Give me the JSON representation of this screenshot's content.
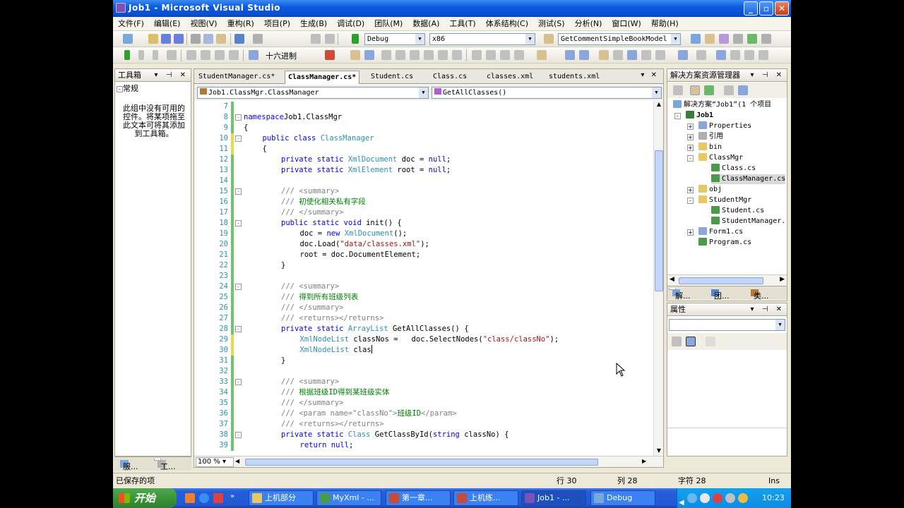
{
  "window": {
    "title": "Job1 - Microsoft Visual Studio"
  },
  "menu": [
    "文件(F)",
    "编辑(E)",
    "视图(V)",
    "重构(R)",
    "项目(P)",
    "生成(B)",
    "调试(D)",
    "团队(M)",
    "数据(A)",
    "工具(T)",
    "体系结构(C)",
    "测试(S)",
    "分析(N)",
    "窗口(W)",
    "帮助(H)"
  ],
  "toolbar": {
    "config": "Debug",
    "platform": "x86",
    "find_combo": "GetCommentSimpleBookModel",
    "hex_label": "十六进制"
  },
  "toolbox": {
    "title": "工具箱",
    "group": "常规",
    "empty_message": "此组中没有可用的控件。将某项拖至此文本可将其添加到工具箱。",
    "bottom_tabs": [
      "服...",
      "工..."
    ]
  },
  "editor": {
    "tabs": [
      "StudentManager.cs*",
      "ClassManager.cs*",
      "Student.cs",
      "Class.cs",
      "classes.xml",
      "students.xml"
    ],
    "active_tab": 1,
    "type_combo": "Job1.ClassMgr.ClassManager",
    "member_combo": "GetAllClasses()",
    "zoom": "100 %",
    "lines": [
      {
        "n": "7",
        "indent": 0,
        "tokens": []
      },
      {
        "n": "8",
        "indent": 0,
        "fold": "-",
        "tokens": [
          [
            "kw",
            "namespace"
          ],
          [
            "",
            "Job1.ClassMgr"
          ]
        ]
      },
      {
        "n": "9",
        "indent": 0,
        "tokens": [
          [
            "",
            "{"
          ]
        ]
      },
      {
        "n": "10",
        "indent": 1,
        "fold": "-",
        "tokens": [
          [
            "kw",
            "public class "
          ],
          [
            "ty",
            "ClassManager"
          ]
        ]
      },
      {
        "n": "11",
        "indent": 1,
        "tokens": [
          [
            "",
            "{"
          ]
        ]
      },
      {
        "n": "12",
        "indent": 2,
        "tokens": [
          [
            "kw",
            "private static "
          ],
          [
            "ty",
            "XmlDocument"
          ],
          [
            "",
            " doc = "
          ],
          [
            "kw",
            "null"
          ],
          [
            "",
            ";"
          ]
        ]
      },
      {
        "n": "13",
        "indent": 2,
        "tokens": [
          [
            "kw",
            "private static "
          ],
          [
            "ty",
            "XmlElement"
          ],
          [
            "",
            " root = "
          ],
          [
            "kw",
            "null"
          ],
          [
            "",
            ";"
          ]
        ]
      },
      {
        "n": "14",
        "indent": 0,
        "tokens": []
      },
      {
        "n": "15",
        "indent": 2,
        "fold": "-",
        "tokens": [
          [
            "cg",
            "/// <summary>"
          ]
        ]
      },
      {
        "n": "16",
        "indent": 2,
        "tokens": [
          [
            "cg",
            "/// "
          ],
          [
            "cm",
            "初使化相关私有字段"
          ]
        ]
      },
      {
        "n": "17",
        "indent": 2,
        "tokens": [
          [
            "cg",
            "/// </summary>"
          ]
        ]
      },
      {
        "n": "18",
        "indent": 2,
        "fold": "-",
        "tokens": [
          [
            "kw",
            "public static void "
          ],
          [
            "",
            "init() {"
          ]
        ]
      },
      {
        "n": "19",
        "indent": 3,
        "tokens": [
          [
            "",
            "doc = "
          ],
          [
            "kw",
            "new "
          ],
          [
            "ty",
            "XmlDocument"
          ],
          [
            "",
            "();"
          ]
        ]
      },
      {
        "n": "20",
        "indent": 3,
        "tokens": [
          [
            "",
            "doc.Load("
          ],
          [
            "st",
            "\"data/classes.xml\""
          ],
          [
            "",
            ");"
          ]
        ]
      },
      {
        "n": "21",
        "indent": 3,
        "tokens": [
          [
            "",
            "root = doc.DocumentElement;"
          ]
        ]
      },
      {
        "n": "22",
        "indent": 2,
        "tokens": [
          [
            "",
            "}"
          ]
        ]
      },
      {
        "n": "23",
        "indent": 0,
        "tokens": []
      },
      {
        "n": "24",
        "indent": 2,
        "fold": "-",
        "tokens": [
          [
            "cg",
            "/// <summary>"
          ]
        ]
      },
      {
        "n": "25",
        "indent": 2,
        "tokens": [
          [
            "cg",
            "/// "
          ],
          [
            "cm",
            "得到所有班级列表"
          ]
        ]
      },
      {
        "n": "26",
        "indent": 2,
        "tokens": [
          [
            "cg",
            "/// </summary>"
          ]
        ]
      },
      {
        "n": "27",
        "indent": 2,
        "tokens": [
          [
            "cg",
            "/// <returns></returns>"
          ]
        ]
      },
      {
        "n": "28",
        "indent": 2,
        "fold": "-",
        "tokens": [
          [
            "kw",
            "private static "
          ],
          [
            "ty",
            "ArrayList"
          ],
          [
            "",
            " GetAllClasses() {"
          ]
        ]
      },
      {
        "n": "29",
        "indent": 3,
        "tokens": [
          [
            "ty",
            "XmlNodeList"
          ],
          [
            "",
            " classNos =   doc.SelectNodes("
          ],
          [
            "st",
            "\"class/classNo\""
          ],
          [
            "",
            ");"
          ]
        ]
      },
      {
        "n": "30",
        "indent": 3,
        "tokens": [
          [
            "ty",
            "XmlNodeList"
          ],
          [
            "",
            " clas"
          ]
        ]
      },
      {
        "n": "31",
        "indent": 2,
        "tokens": [
          [
            "",
            "}"
          ]
        ]
      },
      {
        "n": "32",
        "indent": 0,
        "tokens": []
      },
      {
        "n": "33",
        "indent": 2,
        "fold": "-",
        "tokens": [
          [
            "cg",
            "/// <summary>"
          ]
        ]
      },
      {
        "n": "34",
        "indent": 2,
        "tokens": [
          [
            "cg",
            "/// "
          ],
          [
            "cm",
            "根据班级ID得到某班级实体"
          ]
        ]
      },
      {
        "n": "35",
        "indent": 2,
        "tokens": [
          [
            "cg",
            "/// </summary>"
          ]
        ]
      },
      {
        "n": "36",
        "indent": 2,
        "tokens": [
          [
            "cg",
            "/// <param name=\"classNo\">"
          ],
          [
            "cm",
            "班级ID"
          ],
          [
            "cg",
            "</param>"
          ]
        ]
      },
      {
        "n": "37",
        "indent": 2,
        "tokens": [
          [
            "cg",
            "/// <returns></returns>"
          ]
        ]
      },
      {
        "n": "38",
        "indent": 2,
        "fold": "-",
        "tokens": [
          [
            "kw",
            "private static "
          ],
          [
            "ty",
            "Class"
          ],
          [
            "",
            " GetClassById("
          ],
          [
            "kw",
            "string"
          ],
          [
            "",
            " classNo) {"
          ]
        ]
      },
      {
        "n": "39",
        "indent": 3,
        "tokens": [
          [
            "kw",
            "return null"
          ],
          [
            "",
            ";"
          ]
        ]
      }
    ]
  },
  "solution_explorer": {
    "title": "解决方案资源管理器",
    "items": [
      {
        "label": "解决方案“Job1”(1 个项目",
        "level": 0,
        "icon": "solution-icon",
        "expander": ""
      },
      {
        "label": "Job1",
        "level": 1,
        "icon": "project-icon",
        "expander": "-",
        "bold": true
      },
      {
        "label": "Properties",
        "level": 2,
        "icon": "properties-icon",
        "expander": "+"
      },
      {
        "label": "引用",
        "level": 2,
        "icon": "references-icon",
        "expander": "+"
      },
      {
        "label": "bin",
        "level": 2,
        "icon": "folder-icon",
        "expander": "+"
      },
      {
        "label": "ClassMgr",
        "level": 2,
        "icon": "folder-open-icon",
        "expander": "-"
      },
      {
        "label": "Class.cs",
        "level": 3,
        "icon": "csharp-file-icon",
        "expander": ""
      },
      {
        "label": "ClassManager.cs",
        "level": 3,
        "icon": "csharp-file-icon",
        "expander": "",
        "selected": true
      },
      {
        "label": "obj",
        "level": 2,
        "icon": "folder-icon",
        "expander": "+"
      },
      {
        "label": "StudentMgr",
        "level": 2,
        "icon": "folder-open-icon",
        "expander": "-"
      },
      {
        "label": "Student.cs",
        "level": 3,
        "icon": "csharp-file-icon",
        "expander": ""
      },
      {
        "label": "StudentManager.",
        "level": 3,
        "icon": "csharp-file-icon",
        "expander": ""
      },
      {
        "label": "Form1.cs",
        "level": 2,
        "icon": "form-icon",
        "expander": "+"
      },
      {
        "label": "Program.cs",
        "level": 2,
        "icon": "csharp-file-icon",
        "expander": ""
      }
    ],
    "bottom_tabs": [
      "解...",
      "团...",
      "类..."
    ]
  },
  "properties": {
    "title": "属性"
  },
  "status": {
    "message": "已保存的项",
    "line": "行 30",
    "col": "列 28",
    "char": "字符 28",
    "mode": "Ins"
  },
  "taskbar": {
    "start": "开始",
    "tasks": [
      "上机部分",
      "MyXml - ...",
      "第一章...",
      "上机练...",
      "Job1 - ...",
      "Debug"
    ],
    "active_task": 4,
    "clock": "10:23"
  }
}
